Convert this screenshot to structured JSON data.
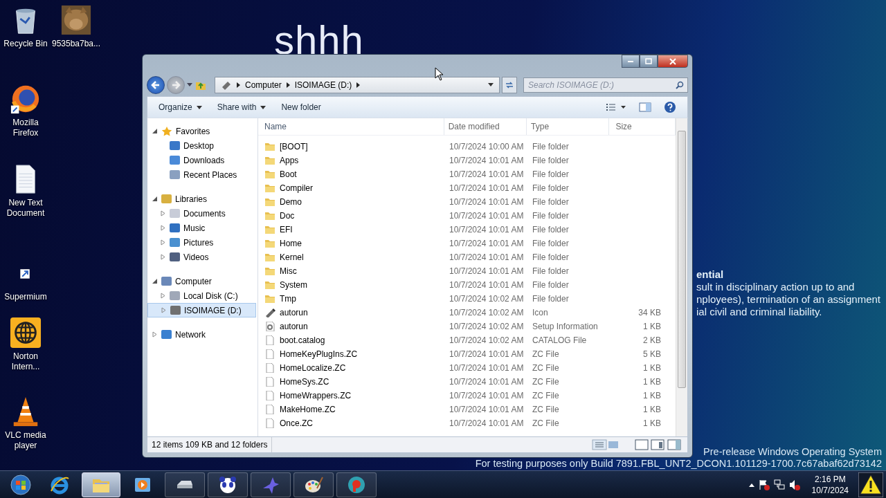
{
  "wallpaper": {
    "title": "shhh",
    "notice_heading": "ential",
    "notice_lines": [
      "sult in disciplinary action up to and",
      "nployees), termination of an assignment",
      "ial civil and criminal liability."
    ],
    "build_lines": [
      "Pre-release Windows Operating System",
      "For testing purposes only  Build 7891.FBL_UNT2_DCON1.101129-1700.7c67abaf62d73142"
    ]
  },
  "desktop_icons": [
    {
      "label": "Recycle Bin",
      "kind": "recycle"
    },
    {
      "label": "9535ba7ba...",
      "kind": "picture"
    },
    {
      "label": "Mozilla Firefox",
      "kind": "firefox"
    },
    {
      "label": "New Text Document",
      "kind": "document"
    },
    {
      "label": "Supermium",
      "kind": "shortcut"
    },
    {
      "label": "Norton Intern...",
      "kind": "norton"
    },
    {
      "label": "VLC media player",
      "kind": "vlc"
    }
  ],
  "window": {
    "address": [
      "Computer",
      "ISOIMAGE (D:)"
    ],
    "search": {
      "placeholder": "Search ISOIMAGE (D:)"
    },
    "toolbar": [
      {
        "label": "Organize",
        "dropdown": true
      },
      {
        "label": "Share with",
        "dropdown": true
      },
      {
        "label": "New folder",
        "dropdown": false
      }
    ],
    "nav": [
      {
        "label": "Favorites",
        "kind": "star",
        "expanded": true,
        "selected": false,
        "children": [
          {
            "label": "Desktop",
            "kind": "desktop",
            "selected": false
          },
          {
            "label": "Downloads",
            "kind": "downloads",
            "selected": false
          },
          {
            "label": "Recent Places",
            "kind": "recent",
            "selected": false
          }
        ]
      },
      {
        "label": "Libraries",
        "kind": "library",
        "expanded": true,
        "selected": false,
        "children": [
          {
            "label": "Documents",
            "kind": "documents",
            "expanded": false,
            "selected": false
          },
          {
            "label": "Music",
            "kind": "music",
            "expanded": false,
            "selected": false
          },
          {
            "label": "Pictures",
            "kind": "pictures",
            "expanded": false,
            "selected": false
          },
          {
            "label": "Videos",
            "kind": "videos",
            "expanded": false,
            "selected": false
          }
        ]
      },
      {
        "label": "Computer",
        "kind": "computer",
        "expanded": true,
        "selected": false,
        "children": [
          {
            "label": "Local Disk (C:)",
            "kind": "disk",
            "expanded": false,
            "selected": false
          },
          {
            "label": "ISOIMAGE (D:)",
            "kind": "cdrom",
            "expanded": false,
            "selected": true
          }
        ]
      },
      {
        "label": "Network",
        "kind": "network",
        "expanded": false,
        "selected": false
      }
    ],
    "columns": [
      "Name",
      "Date modified",
      "Type",
      "Size"
    ],
    "rows": [
      {
        "name": "[BOOT]",
        "date": "10/7/2024 10:00 AM",
        "type": "File folder",
        "kind": "folder"
      },
      {
        "name": "Apps",
        "date": "10/7/2024 10:01 AM",
        "type": "File folder",
        "kind": "folder"
      },
      {
        "name": "Boot",
        "date": "10/7/2024 10:01 AM",
        "type": "File folder",
        "kind": "folder"
      },
      {
        "name": "Compiler",
        "date": "10/7/2024 10:01 AM",
        "type": "File folder",
        "kind": "folder"
      },
      {
        "name": "Demo",
        "date": "10/7/2024 10:01 AM",
        "type": "File folder",
        "kind": "folder"
      },
      {
        "name": "Doc",
        "date": "10/7/2024 10:01 AM",
        "type": "File folder",
        "kind": "folder"
      },
      {
        "name": "EFI",
        "date": "10/7/2024 10:01 AM",
        "type": "File folder",
        "kind": "folder"
      },
      {
        "name": "Home",
        "date": "10/7/2024 10:01 AM",
        "type": "File folder",
        "kind": "folder"
      },
      {
        "name": "Kernel",
        "date": "10/7/2024 10:01 AM",
        "type": "File folder",
        "kind": "folder"
      },
      {
        "name": "Misc",
        "date": "10/7/2024 10:01 AM",
        "type": "File folder",
        "kind": "folder"
      },
      {
        "name": "System",
        "date": "10/7/2024 10:01 AM",
        "type": "File folder",
        "kind": "folder"
      },
      {
        "name": "Tmp",
        "date": "10/7/2024 10:02 AM",
        "type": "File folder",
        "kind": "folder"
      },
      {
        "name": "autorun",
        "date": "10/7/2024 10:02 AM",
        "type": "Icon",
        "size": "34 KB",
        "kind": "icon"
      },
      {
        "name": "autorun",
        "date": "10/7/2024 10:02 AM",
        "type": "Setup Information",
        "size": "1 KB",
        "kind": "setup"
      },
      {
        "name": "boot.catalog",
        "date": "10/7/2024 10:02 AM",
        "type": "CATALOG File",
        "size": "2 KB",
        "kind": "file"
      },
      {
        "name": "HomeKeyPlugIns.ZC",
        "date": "10/7/2024 10:01 AM",
        "type": "ZC File",
        "size": "5 KB",
        "kind": "file"
      },
      {
        "name": "HomeLocalize.ZC",
        "date": "10/7/2024 10:01 AM",
        "type": "ZC File",
        "size": "1 KB",
        "kind": "file"
      },
      {
        "name": "HomeSys.ZC",
        "date": "10/7/2024 10:01 AM",
        "type": "ZC File",
        "size": "1 KB",
        "kind": "file"
      },
      {
        "name": "HomeWrappers.ZC",
        "date": "10/7/2024 10:01 AM",
        "type": "ZC File",
        "size": "1 KB",
        "kind": "file"
      },
      {
        "name": "MakeHome.ZC",
        "date": "10/7/2024 10:01 AM",
        "type": "ZC File",
        "size": "1 KB",
        "kind": "file"
      },
      {
        "name": "Once.ZC",
        "date": "10/7/2024 10:01 AM",
        "type": "ZC File",
        "size": "1 KB",
        "kind": "file"
      }
    ],
    "status": "12 items 109 KB and 12 folders"
  },
  "taskbar": {
    "apps": [
      {
        "kind": "ie",
        "active": false
      },
      {
        "kind": "explorer",
        "active": true
      },
      {
        "kind": "media",
        "active": false
      },
      {
        "kind": "drive",
        "active": false
      },
      {
        "kind": "panda",
        "active": false
      },
      {
        "kind": "bird",
        "active": false
      },
      {
        "kind": "palette",
        "active": false
      },
      {
        "kind": "p-logo",
        "active": false
      }
    ],
    "clock": {
      "time": "2:16 PM",
      "date": "10/7/2024"
    }
  }
}
